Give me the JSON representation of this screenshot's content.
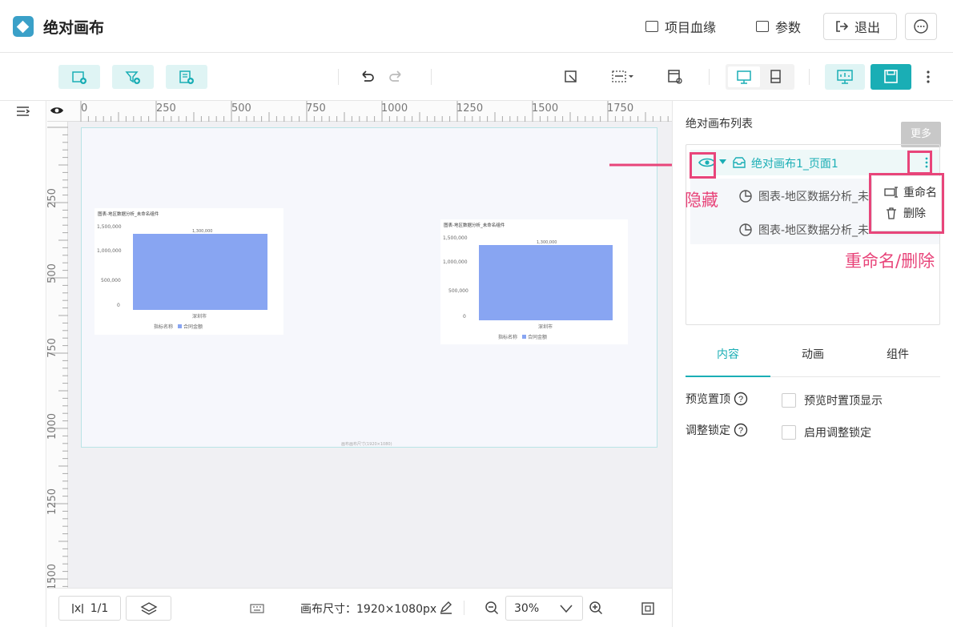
{
  "app": {
    "title": "绝对画布"
  },
  "header": {
    "lineage": "项目血缘",
    "params": "参数",
    "exit": "退出"
  },
  "ruler": {
    "top": [
      "0",
      "250",
      "500",
      "750",
      "1000",
      "1250",
      "1500",
      "1750"
    ],
    "left": [
      "250",
      "500",
      "750",
      "1000",
      "1250",
      "1500"
    ]
  },
  "charts": [
    {
      "title": "图表-地区数据分析_未命名组件",
      "y_ticks": [
        "1,500,000",
        "1,000,000",
        "500,000",
        "0"
      ],
      "bar_label": "1,300,000",
      "category": "深圳市",
      "legend": [
        "指标名称",
        "合同金额"
      ],
      "value": 1300000
    },
    {
      "title": "图表-地区数据分析_未命名组件",
      "y_ticks": [
        "1,500,000",
        "1,000,000",
        "500,000",
        "0"
      ],
      "bar_label": "1,300,000",
      "category": "深圳市",
      "legend": [
        "指标名称",
        "合同金额"
      ],
      "value": 1300000
    }
  ],
  "canvas_footer": "画布画布尺寸(1920×1080)",
  "bottom": {
    "pages": "1/1",
    "size_label": "画布尺寸：1920×1080px",
    "zoom": "30%"
  },
  "panel": {
    "title": "绝对画布列表",
    "more_tooltip": "更多",
    "page_item": "绝对画布1_页面1",
    "children": [
      "图表-地区数据分析_未",
      "图表-地区数据分析_未"
    ],
    "menu": {
      "rename": "重命名",
      "delete": "删除"
    },
    "annot_hide": "隐藏",
    "annot_rename_delete": "重命名/删除",
    "tabs": [
      "内容",
      "动画",
      "组件"
    ],
    "settings": [
      {
        "label": "预览置顶",
        "option": "预览时置顶显示"
      },
      {
        "label": "调整锁定",
        "option": "启用调整锁定"
      }
    ]
  },
  "colors": {
    "accent": "#1aaeb5",
    "bar": "#88a5f2",
    "annotation": "#e8457a"
  }
}
